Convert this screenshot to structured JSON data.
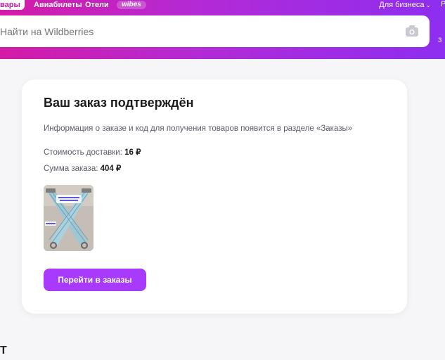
{
  "header": {
    "tabs": [
      "вары",
      "Авиабилеты",
      "Отели",
      "wibes"
    ],
    "business": "Для бизнеса",
    "business_chevron": "⌄",
    "cut_right": "Р",
    "side_letter": "З"
  },
  "search": {
    "placeholder": "Найти на Wildberries"
  },
  "card": {
    "title": "Ваш заказ подтверждён",
    "info": "Информация о заказе и код для получения товаров появится в разделе «Заказы»",
    "delivery_label": "Стоимость доставки:",
    "delivery_value": "16 ₽",
    "total_label": "Сумма заказа:",
    "total_value": "404 ₽",
    "button": "Перейти в заказы"
  },
  "bottom_cut": "Т",
  "colors": {
    "accent": "#a73afd",
    "header_start": "#d41ba7",
    "header_end": "#8d2ef0"
  }
}
